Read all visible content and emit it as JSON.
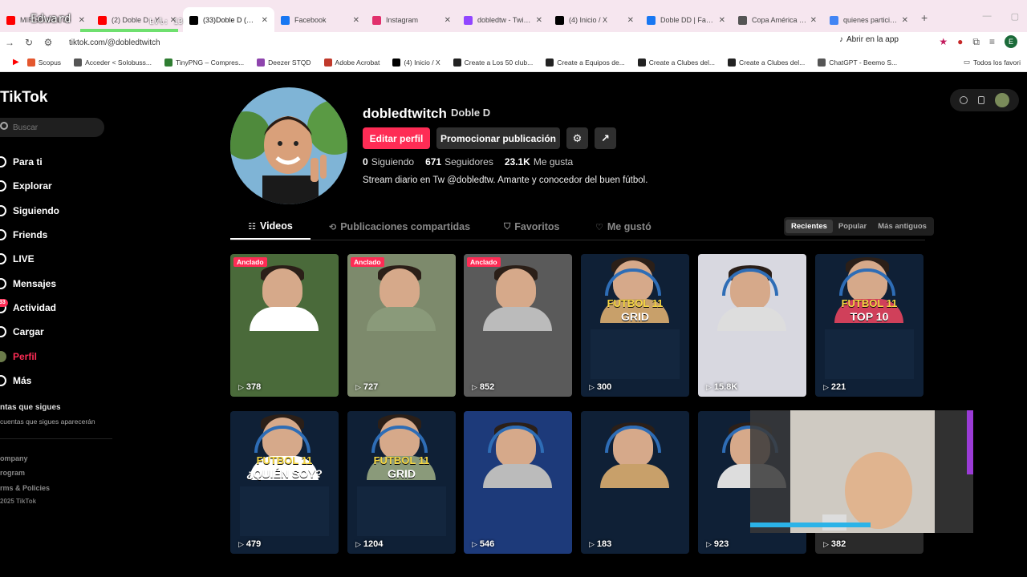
{
  "browser": {
    "tabs": [
      {
        "title": "MIRGR-CHL de",
        "icon": "youtube-icon",
        "color": "#ff0000"
      },
      {
        "title": "(2) Doble D - YouTube",
        "icon": "youtube-icon",
        "color": "#ff0000"
      },
      {
        "title": "(33)Doble D (@dobledtwitch)",
        "icon": "tiktok-icon",
        "color": "#000000",
        "active": true
      },
      {
        "title": "Facebook",
        "icon": "facebook-icon",
        "color": "#1877f2"
      },
      {
        "title": "Instagram",
        "icon": "instagram-icon",
        "color": "#e1306c"
      },
      {
        "title": "dobledtw - Twitch",
        "icon": "twitch-icon",
        "color": "#9146ff"
      },
      {
        "title": "(4) Inicio / X",
        "icon": "x-icon",
        "color": "#000000"
      },
      {
        "title": "Doble DD | Facebook",
        "icon": "facebook-icon",
        "color": "#1877f2"
      },
      {
        "title": "Copa América - Wikipedia",
        "icon": "wikipedia-icon",
        "color": "#555555"
      },
      {
        "title": "quienes participan",
        "icon": "google-icon",
        "color": "#4285f4"
      }
    ],
    "url": "tiktok.com/@dobledtwitch",
    "open_in_app": "Abrir en la app",
    "profile_initial": "E",
    "bookmarks": [
      "Scopus",
      "Acceder < Solobuss...",
      "TinyPNG – Compres...",
      "Deezer STQD",
      "Adobe Acrobat",
      "(4) Inicio / X",
      "Create a Los 50 club...",
      "Create a Equipos de...",
      "Create a Clubes del...",
      "Create a Clubes del...",
      "ChatGPT - Beemo S..."
    ],
    "all_bookmarks": "Todos los favori"
  },
  "stream_overlay": {
    "name": "Edward",
    "level": "Lvl: 13"
  },
  "tiktok": {
    "logo": "TikTok",
    "search_placeholder": "Buscar",
    "nav": [
      {
        "label": "Para ti",
        "icon": "home-icon"
      },
      {
        "label": "Explorar",
        "icon": "compass-icon"
      },
      {
        "label": "Siguiendo",
        "icon": "following-icon"
      },
      {
        "label": "Friends",
        "icon": "friends-icon"
      },
      {
        "label": "LIVE",
        "icon": "live-icon"
      },
      {
        "label": "Mensajes",
        "icon": "messages-icon"
      },
      {
        "label": "Actividad",
        "icon": "activity-icon",
        "badge": "33"
      },
      {
        "label": "Cargar",
        "icon": "upload-icon"
      },
      {
        "label": "Perfil",
        "icon": "profile-icon",
        "active": true
      },
      {
        "label": "Más",
        "icon": "more-icon"
      }
    ],
    "following_header": "ntas que sigues",
    "following_desc": "cuentas que sigues aparecerán",
    "footer": [
      "ompany",
      "rogram",
      "rms & Policies"
    ],
    "copyright": "2025 TikTok"
  },
  "profile": {
    "username": "dobledtwitch",
    "nickname": "Doble D",
    "edit_label": "Editar perfil",
    "promote_label": "Promocionar publicación",
    "following_count": "0",
    "following_label": "Siguiendo",
    "followers_count": "671",
    "followers_label": "Seguidores",
    "likes_count": "23.1K",
    "likes_label": "Me gusta",
    "bio": "Stream diario en Tw @dobledtw. Amante y conocedor del buen fútbol."
  },
  "tabs": [
    {
      "label": "Videos",
      "icon": "grid-icon",
      "active": true
    },
    {
      "label": "Publicaciones compartidas",
      "icon": "repost-icon"
    },
    {
      "label": "Favoritos",
      "icon": "bookmark-icon"
    },
    {
      "label": "Me gustó",
      "icon": "heart-icon"
    }
  ],
  "sort": [
    "Recientes",
    "Popular",
    "Más antiguos"
  ],
  "pinned_label": "Anclado",
  "videos": [
    {
      "views": "378",
      "pinned": true,
      "title1": "",
      "title2": "",
      "bg": "#4a6a3a"
    },
    {
      "views": "727",
      "pinned": true,
      "title1": "",
      "title2": "",
      "bg": "#7d8a6c"
    },
    {
      "views": "852",
      "pinned": true,
      "title1": "",
      "title2": "",
      "bg": "#5a5a5a"
    },
    {
      "views": "300",
      "pinned": false,
      "title1": "FUTBOL 11",
      "title2": "GRID",
      "bg": "#0f2036"
    },
    {
      "views": "15.8K",
      "pinned": false,
      "title1": "",
      "title2": "",
      "bg": "#d8d8e0"
    },
    {
      "views": "221",
      "pinned": false,
      "title1": "FUTBOL 11",
      "title2": "TOP 10",
      "bg": "#0f2036"
    },
    {
      "views": "479",
      "pinned": false,
      "title1": "FUTBOL 11",
      "title2": "¿QUIÉN SOY?",
      "bg": "#0f2036"
    },
    {
      "views": "1204",
      "pinned": false,
      "title1": "FUTBOL 11",
      "title2": "GRID",
      "bg": "#0f2036"
    },
    {
      "views": "546",
      "pinned": false,
      "title1": "",
      "title2": "",
      "bg": "#1d3a7a"
    },
    {
      "views": "183",
      "pinned": false,
      "title1": "",
      "title2": "",
      "bg": "#0f2036"
    },
    {
      "views": "923",
      "pinned": false,
      "title1": "",
      "title2": "",
      "bg": "#0f2036"
    },
    {
      "views": "382",
      "pinned": false,
      "title1": "",
      "title2": "",
      "bg": "#2a2a2a"
    }
  ],
  "colors": {
    "accent": "#fe2c55"
  }
}
